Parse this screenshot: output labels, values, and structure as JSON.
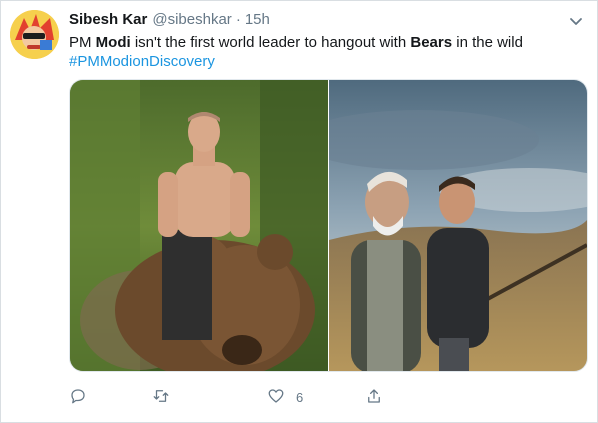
{
  "tweet": {
    "author_name": "Sibesh Kar",
    "author_handle": "@sibeshkar",
    "separator": "·",
    "timestamp": "15h",
    "text": {
      "part1": "PM ",
      "bold1": "Modi",
      "part2": " isn't the first world leader to hangout with ",
      "bold2": "Bears",
      "part3": " in the wild",
      "hashtag": "#PMModionDiscovery"
    },
    "media": [
      {
        "description": "shirtless man riding a brown bear"
      },
      {
        "description": "two men walking through grassland under cloudy sky"
      }
    ],
    "actions": {
      "reply_count": "",
      "retweet_count": "",
      "like_count": "6",
      "share_count": ""
    }
  },
  "colors": {
    "link": "#1b95e0",
    "muted": "#657786",
    "text": "#14171a"
  },
  "icons": {
    "reply": "reply-icon",
    "retweet": "retweet-icon",
    "like": "heart-icon",
    "share": "share-icon",
    "menu": "chevron-down-icon"
  }
}
